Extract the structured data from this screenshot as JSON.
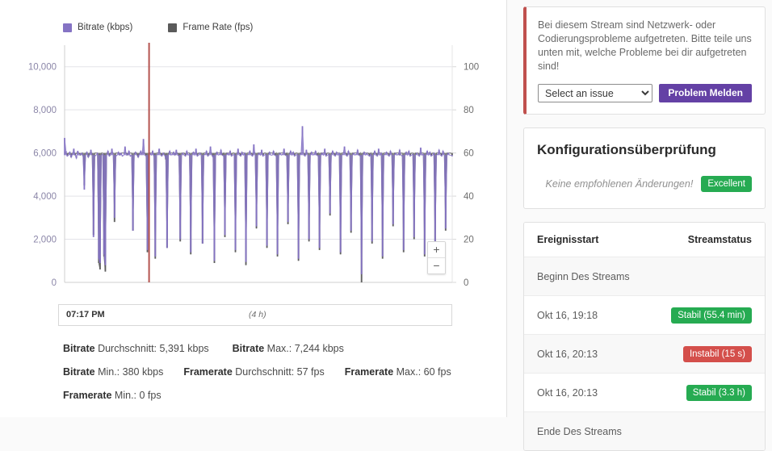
{
  "chart_data": {
    "type": "line",
    "title": "",
    "xlabel": "",
    "ylabel": "Bitrate (kbps)",
    "ylabel_right": "Frame Rate (fps)",
    "ylim": [
      0,
      11000
    ],
    "ylim_right": [
      0,
      110
    ],
    "yticks": [
      "0",
      "2,000",
      "4,000",
      "6,000",
      "8,000",
      "10,000"
    ],
    "ytick_values": [
      0,
      2000,
      4000,
      6000,
      8000,
      10000
    ],
    "yticks_right": [
      "0",
      "20",
      "40",
      "60",
      "80",
      "100"
    ],
    "ytick_values_right": [
      0,
      20,
      40,
      60,
      80,
      100
    ],
    "grid": true,
    "legend_position": "top-left",
    "series": [
      {
        "name": "Bitrate (kbps)",
        "color": "#8573c4",
        "axis": "left",
        "baseline": 5900,
        "values": [
          6700,
          6100,
          5850,
          5900,
          6050,
          5800,
          5950,
          6200,
          5900,
          5750,
          6100,
          5900,
          5950,
          6000,
          5850,
          4300,
          5900,
          6050,
          5800,
          5900,
          6150,
          5900,
          2100,
          5850,
          5900,
          6000,
          1100,
          900,
          5900,
          5950,
          1300,
          800,
          5900,
          6100,
          5850,
          5900,
          6200,
          5900,
          3000,
          5850,
          5900,
          6050,
          5900,
          6000,
          5850,
          5900,
          6300,
          5900,
          5950,
          6100,
          5850,
          5900,
          2400,
          5900,
          6050,
          5900,
          5800,
          5950,
          6100,
          5900,
          6650,
          5900,
          5850,
          1500,
          5900,
          6000,
          5900,
          6100,
          5850,
          1200,
          5900,
          5950,
          6200,
          5900,
          5850,
          6000,
          5900,
          5750,
          1600,
          5900,
          6100,
          5900,
          5950,
          6050,
          5900,
          6150,
          5900,
          5850,
          2000,
          5900,
          6000,
          5900,
          5850,
          6100,
          5900,
          5950,
          1400,
          5900,
          6050,
          5900,
          6200,
          5850,
          5900,
          6000,
          5900,
          1800,
          5900,
          5950,
          6100,
          5850,
          5900,
          6300,
          5900,
          5800,
          1000,
          5900,
          6050,
          5900,
          5950,
          6150,
          5900,
          5850,
          2200,
          5900,
          6000,
          5900,
          6100,
          5850,
          5900,
          5950,
          1500,
          5900,
          6200,
          5900,
          5850,
          6050,
          5900,
          6000,
          950,
          5900,
          5950,
          6100,
          5900,
          5850,
          6400,
          5900,
          2600,
          5900,
          6000,
          5900,
          6150,
          5850,
          5900,
          5950,
          1700,
          5900,
          6050,
          5900,
          5900,
          6100,
          5900,
          5850,
          1300,
          5900,
          6000,
          5900,
          5950,
          6200,
          5900,
          5850,
          2800,
          5900,
          6100,
          5900,
          6050,
          5850,
          5900,
          5950,
          1100,
          5900,
          6000,
          7244,
          5900,
          5850,
          6150,
          5900,
          2000,
          5900,
          6050,
          5900,
          5950,
          6100,
          5900,
          5850,
          1600,
          5900,
          6000,
          5900,
          6200,
          5850,
          5900,
          5950,
          3200,
          5900,
          6100,
          5900,
          5850,
          6050,
          5900,
          6000,
          1400,
          5900,
          5950,
          6300,
          5900,
          5850,
          6100,
          5900,
          2400,
          5900,
          6000,
          5900,
          5950,
          6150,
          5900,
          5850,
          380,
          5900,
          6050,
          5900,
          6000,
          5900,
          5850,
          5950,
          1900,
          5900,
          6100,
          5900,
          5850,
          6200,
          5900,
          6000,
          1200,
          5900,
          5950,
          6050,
          5900,
          5850,
          6100,
          5900,
          2700,
          5900,
          6000,
          5900,
          5950,
          6150,
          5900,
          5850,
          1500,
          5900,
          6050,
          5900,
          6100,
          5850,
          5900,
          5950,
          2100,
          5900,
          6000,
          5900,
          5850,
          6250,
          5900,
          5950,
          1300,
          5900,
          6100,
          5900,
          6050,
          5850,
          5900,
          6000,
          1800,
          5900,
          5950,
          6150,
          5900,
          5850,
          6100,
          5900,
          2500,
          5900,
          6000,
          5900,
          5900,
          5850
        ]
      },
      {
        "name": "Frame Rate (fps)",
        "color": "#5a5a5a",
        "axis": "right",
        "baseline": 60,
        "values": [
          60,
          60,
          59,
          60,
          60,
          58,
          60,
          60,
          59,
          60,
          60,
          60,
          59,
          60,
          60,
          45,
          60,
          60,
          58,
          60,
          60,
          59,
          22,
          60,
          60,
          60,
          9,
          6,
          60,
          60,
          12,
          5,
          60,
          60,
          59,
          60,
          60,
          60,
          28,
          60,
          60,
          60,
          59,
          60,
          60,
          60,
          60,
          60,
          59,
          60,
          60,
          60,
          24,
          60,
          60,
          60,
          58,
          60,
          60,
          60,
          60,
          60,
          59,
          14,
          60,
          60,
          60,
          60,
          59,
          11,
          60,
          60,
          60,
          60,
          59,
          60,
          60,
          57,
          16,
          60,
          60,
          60,
          60,
          60,
          59,
          60,
          60,
          59,
          19,
          60,
          60,
          60,
          59,
          60,
          60,
          60,
          13,
          60,
          60,
          60,
          60,
          59,
          60,
          60,
          60,
          18,
          60,
          60,
          60,
          59,
          60,
          60,
          60,
          58,
          9,
          60,
          60,
          60,
          60,
          60,
          59,
          60,
          21,
          60,
          60,
          60,
          60,
          59,
          60,
          60,
          14,
          60,
          60,
          60,
          59,
          60,
          60,
          60,
          8,
          60,
          60,
          60,
          60,
          59,
          60,
          60,
          25,
          60,
          60,
          60,
          60,
          59,
          60,
          60,
          16,
          60,
          60,
          60,
          60,
          60,
          59,
          60,
          12,
          60,
          60,
          60,
          60,
          60,
          59,
          60,
          27,
          60,
          60,
          60,
          60,
          59,
          60,
          60,
          10,
          60,
          60,
          60,
          60,
          59,
          60,
          60,
          19,
          60,
          60,
          60,
          60,
          60,
          59,
          60,
          15,
          60,
          60,
          60,
          60,
          59,
          60,
          60,
          31,
          60,
          60,
          60,
          59,
          60,
          60,
          60,
          13,
          60,
          60,
          60,
          60,
          59,
          60,
          60,
          23,
          60,
          60,
          60,
          60,
          60,
          59,
          60,
          0,
          60,
          60,
          60,
          60,
          60,
          59,
          60,
          18,
          60,
          60,
          60,
          59,
          60,
          60,
          60,
          11,
          60,
          60,
          60,
          60,
          59,
          60,
          60,
          26,
          60,
          60,
          60,
          60,
          59,
          60,
          60,
          14,
          60,
          60,
          60,
          60,
          59,
          60,
          60,
          20,
          60,
          60,
          60,
          59,
          60,
          60,
          60,
          12,
          60,
          60,
          60,
          60,
          59,
          60,
          60,
          17,
          60,
          60,
          60,
          60,
          59,
          60,
          60,
          24,
          60,
          60,
          60,
          60,
          59
        ]
      }
    ],
    "marker_line": {
      "position_ratio": 0.218,
      "color": "#b5534f"
    }
  },
  "left_panel": {
    "legend": [
      {
        "label": "Bitrate (kbps)",
        "color": "#8573c4"
      },
      {
        "label": "Frame Rate (fps)",
        "color": "#5a5a5a"
      }
    ],
    "zoom_in_label": "+",
    "zoom_out_label": "−",
    "range_bar": {
      "start_time": "07:17 PM",
      "duration": "(4 h)"
    },
    "stats": {
      "bitrate_avg_label": "Bitrate",
      "bitrate_avg_rest": " Durchschnitt: 5,391 kbps",
      "bitrate_max_label": "Bitrate",
      "bitrate_max_rest": " Max.: 7,244 kbps",
      "bitrate_min_label": "Bitrate",
      "bitrate_min_rest": " Min.: 380 kbps",
      "framerate_avg_label": "Framerate",
      "framerate_avg_rest": " Durchschnitt: 57 fps",
      "framerate_max_label": "Framerate",
      "framerate_max_rest": " Max.: 60 fps",
      "framerate_min_label": "Framerate",
      "framerate_min_rest": " Min.: 0 fps"
    }
  },
  "right_panel": {
    "alert": {
      "message": "Bei diesem Stream sind Netzwerk- oder Codierungsprobleme aufgetreten. Bitte teile uns unten mit, welche Probleme bei dir aufgetreten sind!",
      "select_value": "Select an issue",
      "select_options": [
        "Select an issue"
      ],
      "report_button": "Problem Melden",
      "accent_color": "#c0504d"
    },
    "config": {
      "title": "Konfigurationsüberprüfung",
      "message": "Keine empfohlenen Änderungen!",
      "badge": "Excellent",
      "badge_color": "#26ab52"
    },
    "events": {
      "col_time": "Ereignisstart",
      "col_status": "Streamstatus",
      "rows": [
        {
          "time": "Beginn Des Streams",
          "status": "",
          "status_type": "none"
        },
        {
          "time": "Okt 16, 19:18",
          "status": "Stabil (55.4 min)",
          "status_type": "stable"
        },
        {
          "time": "Okt 16, 20:13",
          "status": "Instabil (15 s)",
          "status_type": "unstable"
        },
        {
          "time": "Okt 16, 20:13",
          "status": "Stabil (3.3 h)",
          "status_type": "stable"
        },
        {
          "time": "Ende Des Streams",
          "status": "",
          "status_type": "none"
        }
      ]
    }
  }
}
